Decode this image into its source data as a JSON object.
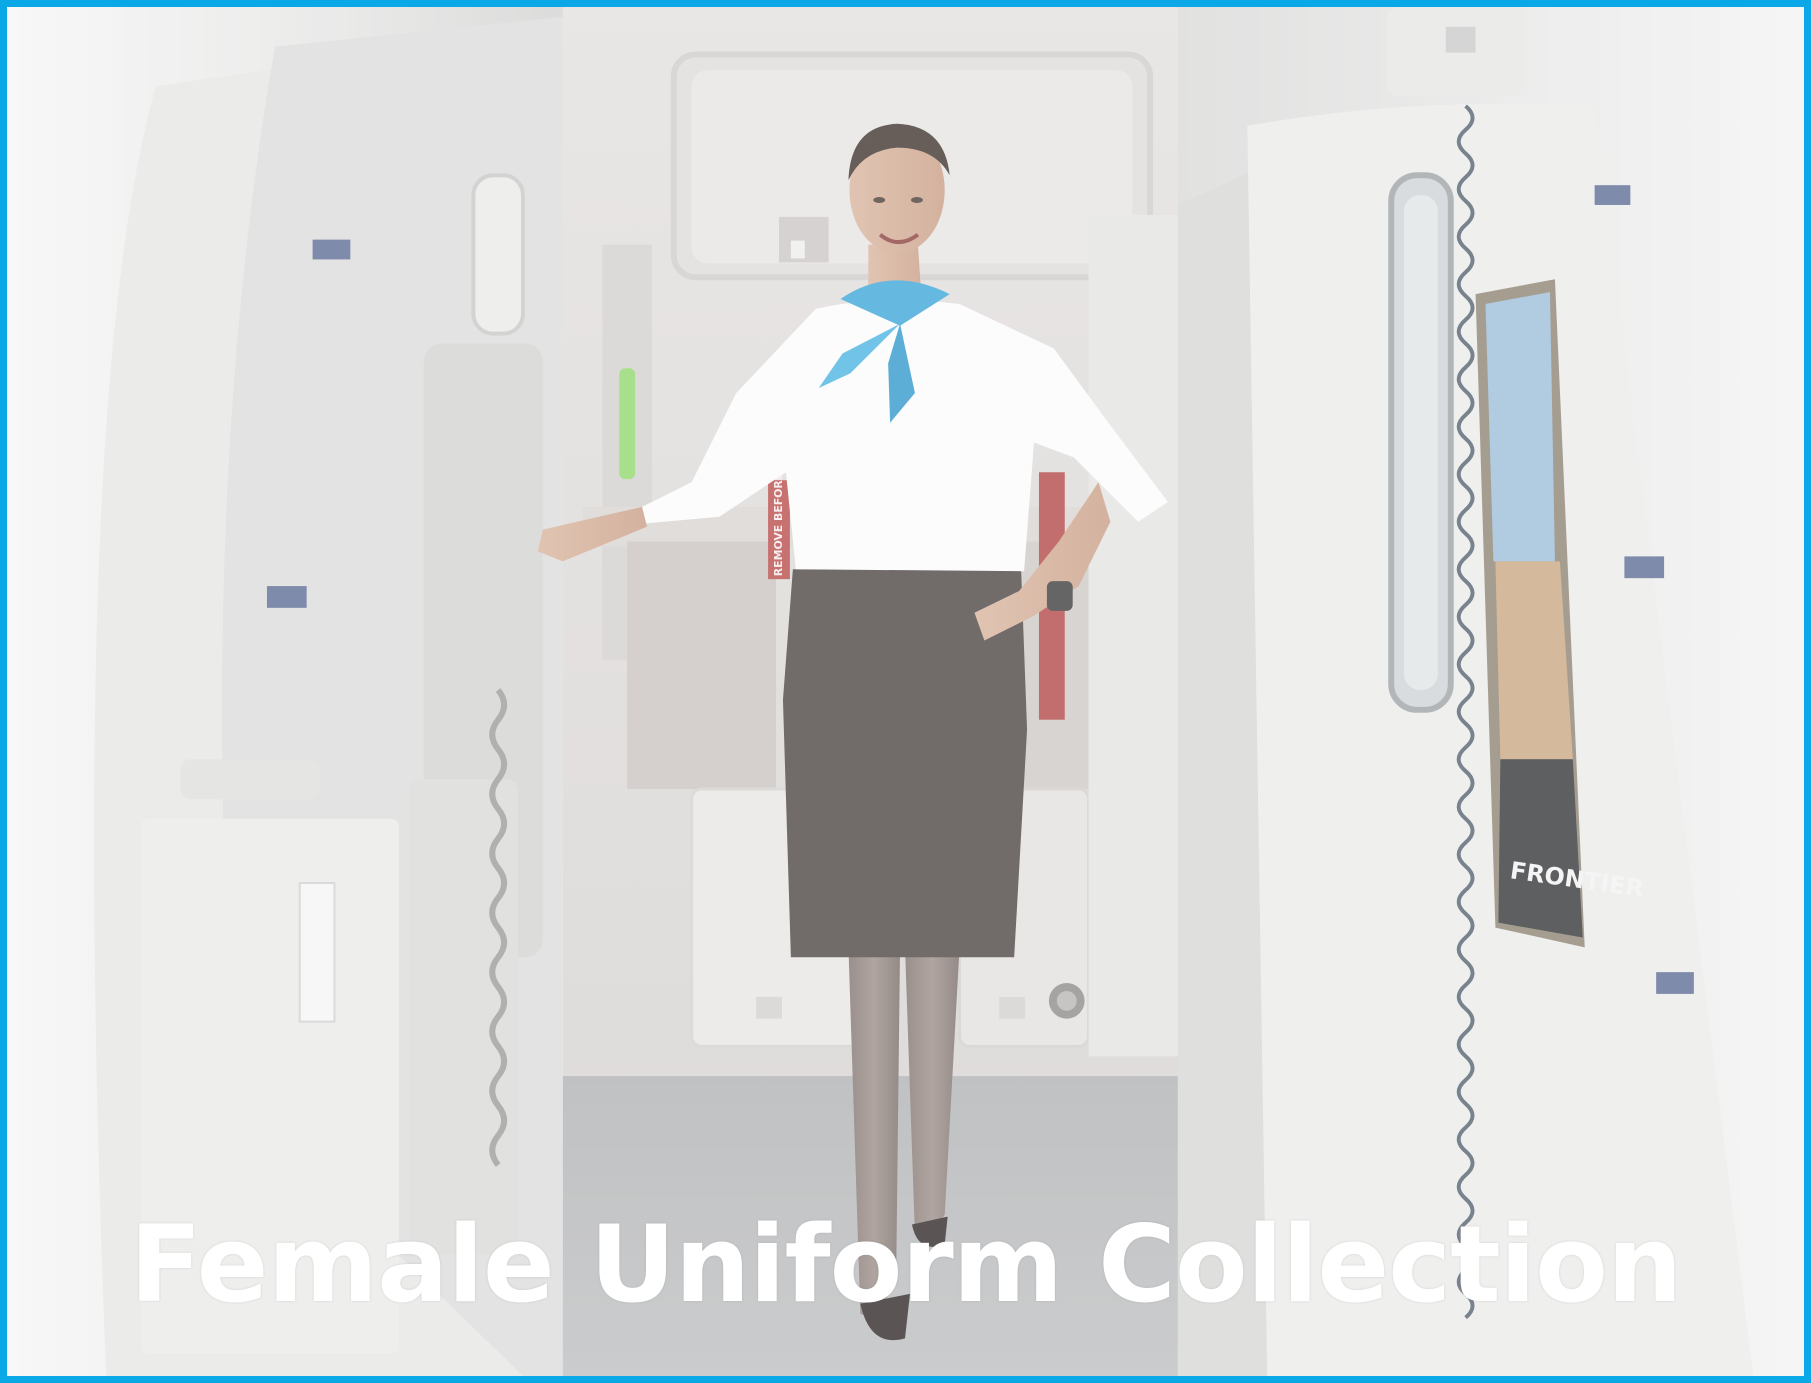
{
  "title": "Female Uniform Collection",
  "poster_text": "FRONTIER",
  "tag_text": "REMOVE BEFORE FLIGHT",
  "colors": {
    "frame_border": "#0aa8e6",
    "caption": "#ffffff",
    "scarf": "#3aa6d8",
    "shirt": "#fbfbfb",
    "skirt": "#4a4240",
    "handle": "#8fd66a",
    "tag": "#b84a4a"
  }
}
